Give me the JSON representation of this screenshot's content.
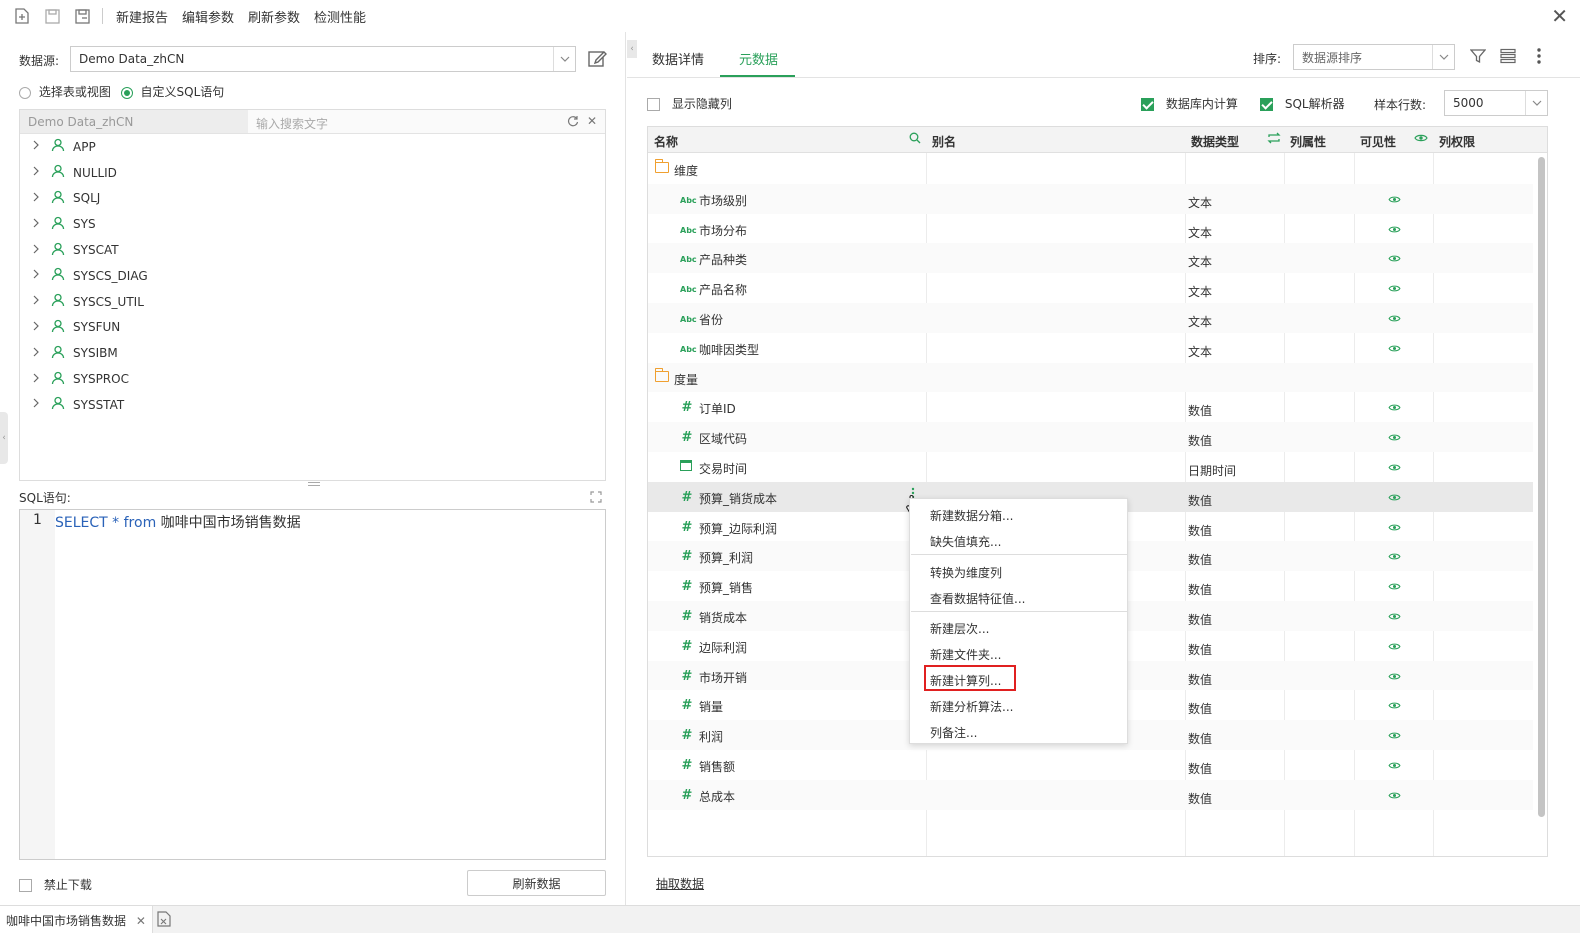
{
  "toolbar": {
    "new_report": "新建报告",
    "edit_params": "编辑参数",
    "refresh_params": "刷新参数",
    "check_perf": "检测性能"
  },
  "left": {
    "datasource_label": "数据源:",
    "datasource_value": "Demo Data_zhCN",
    "radio_table": "选择表或视图",
    "radio_sql": "自定义SQL语句",
    "tree_source": "Demo Data_zhCN",
    "tree_search_placeholder": "输入搜索文字",
    "tree_items": [
      "APP",
      "NULLID",
      "SQLJ",
      "SYS",
      "SYSCAT",
      "SYSCS_DIAG",
      "SYSCS_UTIL",
      "SYSFUN",
      "SYSIBM",
      "SYSPROC",
      "SYSSTAT"
    ],
    "sql_label": "SQL语句:",
    "sql_line_no": "1",
    "sql_select": "SELECT",
    "sql_star": "*",
    "sql_from": "from",
    "sql_table": "咖啡中国市场销售数据",
    "disable_download": "禁止下载",
    "refresh_data": "刷新数据"
  },
  "bottom": {
    "tab_label": "咖啡中国市场销售数据"
  },
  "right": {
    "tab_details": "数据详情",
    "tab_meta": "元数据",
    "sort_label": "排序:",
    "sort_value": "数据源排序",
    "show_hidden": "显示隐藏列",
    "db_compute": "数据库内计算",
    "sql_parser": "SQL解析器",
    "sample_rows_label": "样本行数:",
    "sample_rows_value": "5000",
    "extract_data": "抽取数据",
    "columns": {
      "name": "名称",
      "alias": "别名",
      "type": "数据类型",
      "attr": "列属性",
      "visible": "可见性",
      "perm": "列权限"
    },
    "rows": [
      {
        "kind": "folder",
        "name": "维度",
        "type": ""
      },
      {
        "kind": "abc",
        "name": "市场级别",
        "type": "文本"
      },
      {
        "kind": "abc",
        "name": "市场分布",
        "type": "文本"
      },
      {
        "kind": "abc",
        "name": "产品种类",
        "type": "文本"
      },
      {
        "kind": "abc",
        "name": "产品名称",
        "type": "文本"
      },
      {
        "kind": "abc",
        "name": "省份",
        "type": "文本"
      },
      {
        "kind": "abc",
        "name": "咖啡因类型",
        "type": "文本"
      },
      {
        "kind": "folder",
        "name": "度量",
        "type": ""
      },
      {
        "kind": "num",
        "name": "订单ID",
        "type": "数值"
      },
      {
        "kind": "num",
        "name": "区域代码",
        "type": "数值"
      },
      {
        "kind": "date",
        "name": "交易时间",
        "type": "日期时间"
      },
      {
        "kind": "num",
        "name": "预算_销货成本",
        "type": "数值"
      },
      {
        "kind": "num",
        "name": "预算_边际利润",
        "type": "数值"
      },
      {
        "kind": "num",
        "name": "预算_利润",
        "type": "数值"
      },
      {
        "kind": "num",
        "name": "预算_销售",
        "type": "数值"
      },
      {
        "kind": "num",
        "name": "销货成本",
        "type": "数值"
      },
      {
        "kind": "num",
        "name": "边际利润",
        "type": "数值"
      },
      {
        "kind": "num",
        "name": "市场开销",
        "type": "数值"
      },
      {
        "kind": "num",
        "name": "销量",
        "type": "数值"
      },
      {
        "kind": "num",
        "name": "利润",
        "type": "数值"
      },
      {
        "kind": "num",
        "name": "销售额",
        "type": "数值"
      },
      {
        "kind": "num",
        "name": "总成本",
        "type": "数值"
      }
    ]
  },
  "context_menu": {
    "items": [
      "新建数据分箱...",
      "缺失值填充...",
      "转换为维度列",
      "查看数据特征值...",
      "新建层次...",
      "新建文件夹...",
      "新建计算列...",
      "新建分析算法...",
      "列备注..."
    ]
  },
  "colors": {
    "accent": "#2aa05a",
    "highlight_border": "#e02020",
    "folder": "#f0a030"
  }
}
